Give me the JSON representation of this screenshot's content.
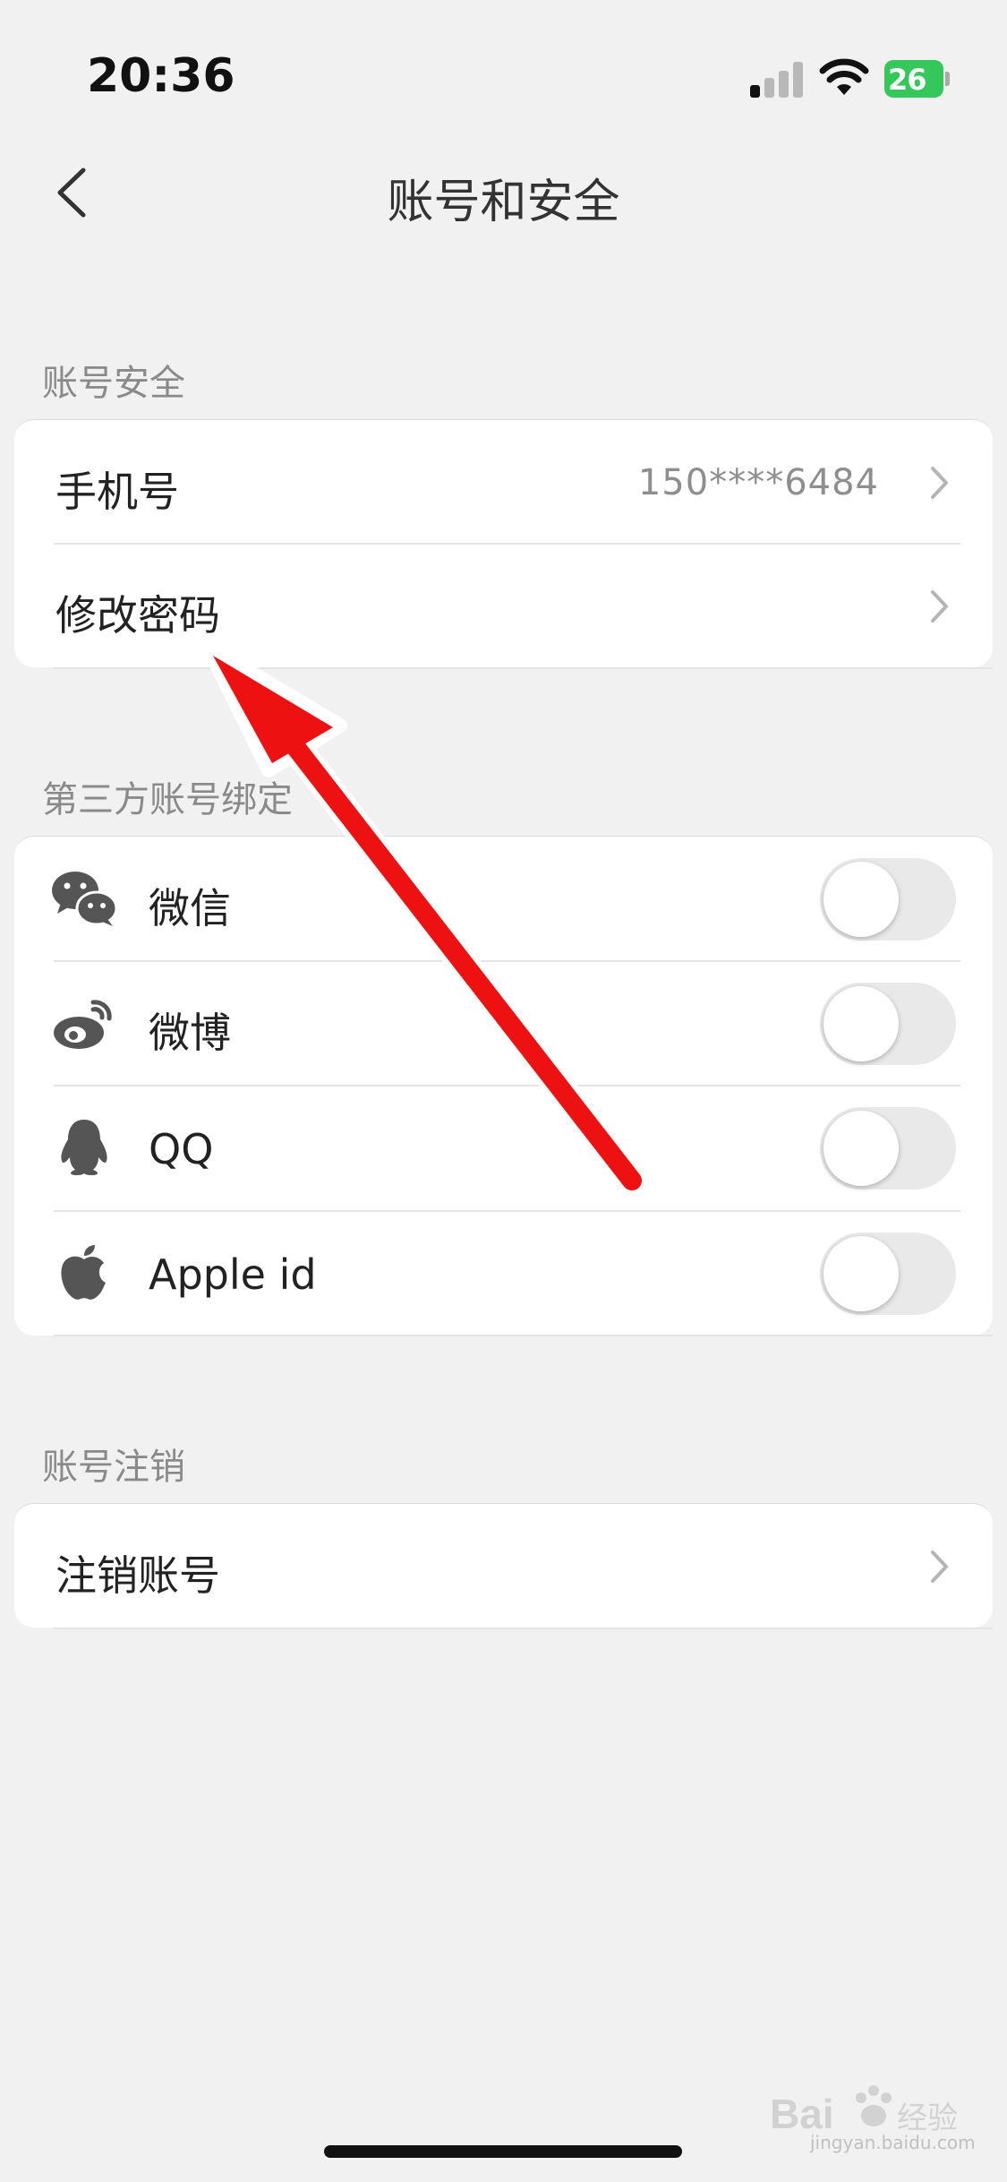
{
  "status_bar": {
    "time": "20:36",
    "battery": "26"
  },
  "nav": {
    "title": "账号和安全"
  },
  "account_security": {
    "label": "账号安全",
    "phone": {
      "label": "手机号",
      "value": "150****6484"
    },
    "change_password": {
      "label": "修改密码"
    }
  },
  "third_party": {
    "label": "第三方账号绑定",
    "items": [
      {
        "label": "微信",
        "icon": "wechat-icon",
        "enabled": false
      },
      {
        "label": "微博",
        "icon": "weibo-icon",
        "enabled": false
      },
      {
        "label": "QQ",
        "icon": "qq-icon",
        "enabled": false
      },
      {
        "label": "Apple id",
        "icon": "apple-icon",
        "enabled": false
      }
    ]
  },
  "deregistration": {
    "label": "账号注销",
    "cancel_account": {
      "label": "注销账号"
    }
  },
  "watermark": {
    "brand": "Bai",
    "brand_cn": "经验",
    "url": "jingyan.baidu.com"
  },
  "colors": {
    "background": "#f1f1f2",
    "annotation_arrow": "#ee1111",
    "battery": "#34c759"
  }
}
